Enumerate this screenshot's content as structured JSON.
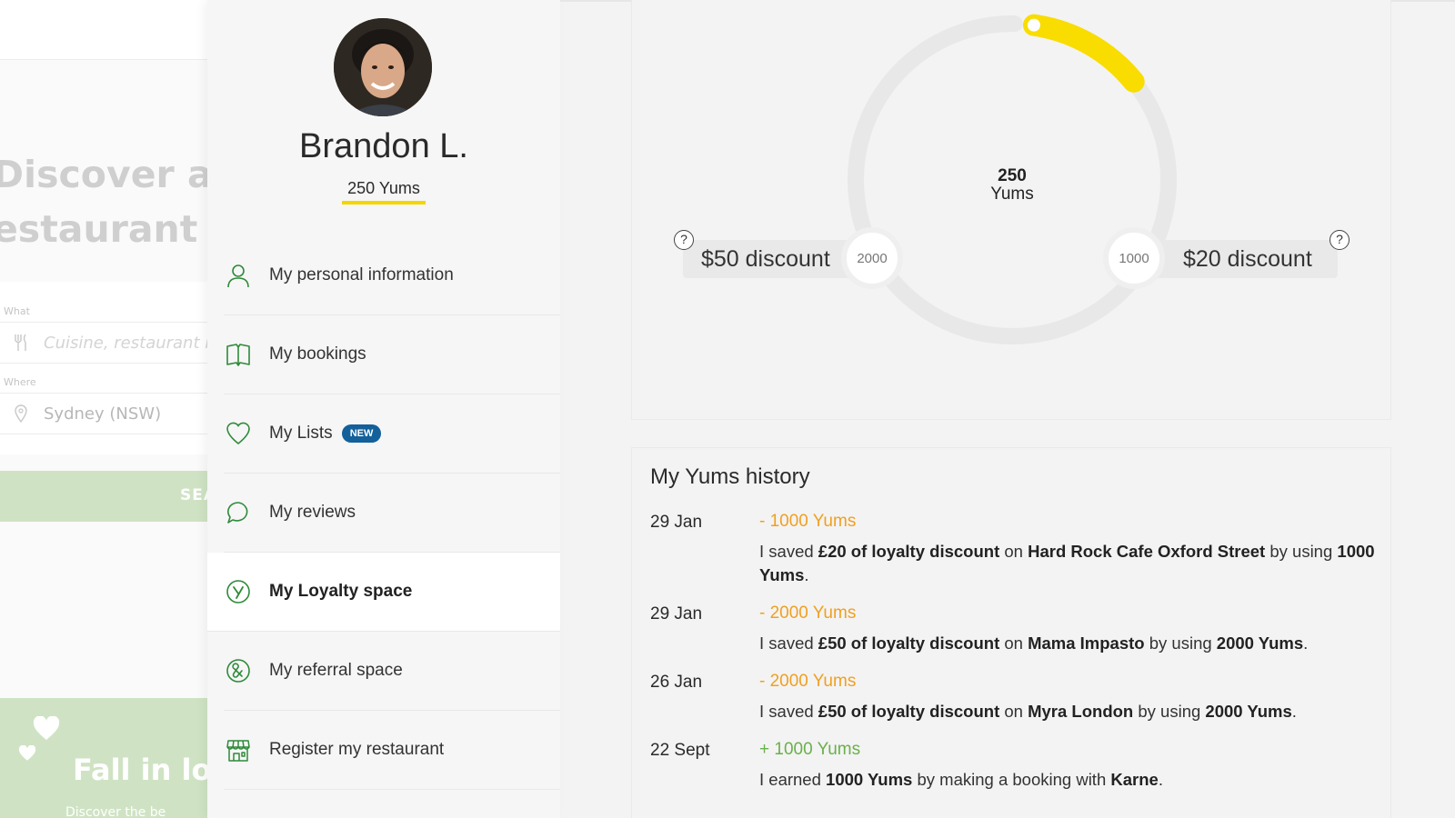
{
  "background": {
    "hero_title_line1": "Discover and",
    "hero_title_line2": "estaurant",
    "what_label": "What",
    "what_placeholder": "Cuisine, restaurant n",
    "where_label": "Where",
    "where_value": "Sydney (NSW)",
    "search_label": "SEA",
    "promo_title": "Fall in lo",
    "promo_sub": "Discover the be"
  },
  "profile": {
    "name": "Brandon L.",
    "yums": "250 Yums"
  },
  "menu": {
    "items": [
      {
        "label": "My personal information",
        "icon": "person-icon"
      },
      {
        "label": "My bookings",
        "icon": "book-icon"
      },
      {
        "label": "My Lists",
        "icon": "heart-icon",
        "badge": "NEW"
      },
      {
        "label": "My reviews",
        "icon": "chat-bubble-icon"
      },
      {
        "label": "My Loyalty space",
        "icon": "yums-logo-icon",
        "active": true
      },
      {
        "label": "My referral space",
        "icon": "referral-icon"
      },
      {
        "label": "Register my restaurant",
        "icon": "storefront-icon"
      }
    ]
  },
  "gauge": {
    "center_value": "250",
    "center_unit": "Yums",
    "progress_fraction": 0.125,
    "left_reward": "$50 discount",
    "left_threshold": "2000",
    "right_reward": "$20 discount",
    "right_threshold": "1000",
    "help_glyph": "?",
    "accent_color": "#f9dc00",
    "track_color": "#e8e8e8"
  },
  "history": {
    "title": "My Yums history",
    "entries": [
      {
        "date": "29 Jan",
        "amount": "- 1000 Yums",
        "type": "minus",
        "parts": [
          "I saved ",
          "£20 of loyalty discount",
          " on ",
          "Hard Rock Cafe Oxford Street",
          " by using ",
          "1000 Yums",
          "."
        ]
      },
      {
        "date": "29 Jan",
        "amount": "- 2000 Yums",
        "type": "minus",
        "parts": [
          "I saved ",
          "£50 of loyalty discount",
          " on ",
          "Mama Impasto",
          " by using ",
          "2000 Yums",
          "."
        ]
      },
      {
        "date": "26 Jan",
        "amount": "- 2000 Yums",
        "type": "minus",
        "parts": [
          "I saved ",
          "£50 of loyalty discount",
          " on ",
          "Myra London",
          " by using ",
          "2000 Yums",
          "."
        ]
      },
      {
        "date": "22 Sept",
        "amount": "+ 1000 Yums",
        "type": "plus",
        "parts": [
          "I earned ",
          "1000 Yums",
          " by making a booking with ",
          "Karne",
          "."
        ]
      }
    ]
  }
}
